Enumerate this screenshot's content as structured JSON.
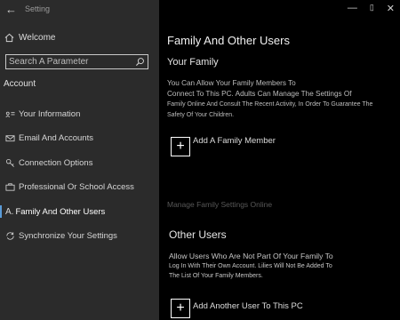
{
  "window": {
    "title": "Setting",
    "back_icon": "back-arrow-icon",
    "controls": {
      "minimize": "—",
      "maximize": "⃞",
      "close": "✕"
    }
  },
  "sidebar": {
    "home_label": "Welcome",
    "search_placeholder": "Search A Parameter",
    "section_label": "Account",
    "items": [
      {
        "icon": "person-card-icon",
        "label": "Your Information"
      },
      {
        "icon": "envelope-icon",
        "label": "Email And Accounts"
      },
      {
        "icon": "key-icon",
        "label": "Connection Options"
      },
      {
        "icon": "briefcase-icon",
        "label": "Professional Or School Access"
      },
      {
        "icon": "family-icon",
        "label": "Family And Other Users"
      },
      {
        "icon": "sync-icon",
        "label": "Synchronize Your Settings"
      }
    ],
    "active_index": 4
  },
  "main": {
    "title": "Family And Other Users",
    "family": {
      "heading": "Your Family",
      "description_line1": "You Can Allow Your Family Members To",
      "description_line2": "Connect To This PC. Adults Can Manage The Settings Of",
      "description_line3": "Family Online And Consult The Recent Activity, In Order To Guarantee The",
      "description_line4": "Safety Of Your Children.",
      "add_label": "Add A Family Member",
      "manage_link": "Manage Family Settings Online"
    },
    "other": {
      "heading": "Other Users",
      "description_line1": "Allow Users Who Are Not Part Of Your Family To",
      "description_line2": "Log In With Their Own Account. Lilies Will Not Be Added To",
      "description_line3": "The List Of Your Family Members.",
      "add_label": "Add Another User To This PC"
    }
  },
  "colors": {
    "sidebar_bg": "#2b2b2b",
    "main_bg": "#000000",
    "accent": "#5a9bd8"
  }
}
